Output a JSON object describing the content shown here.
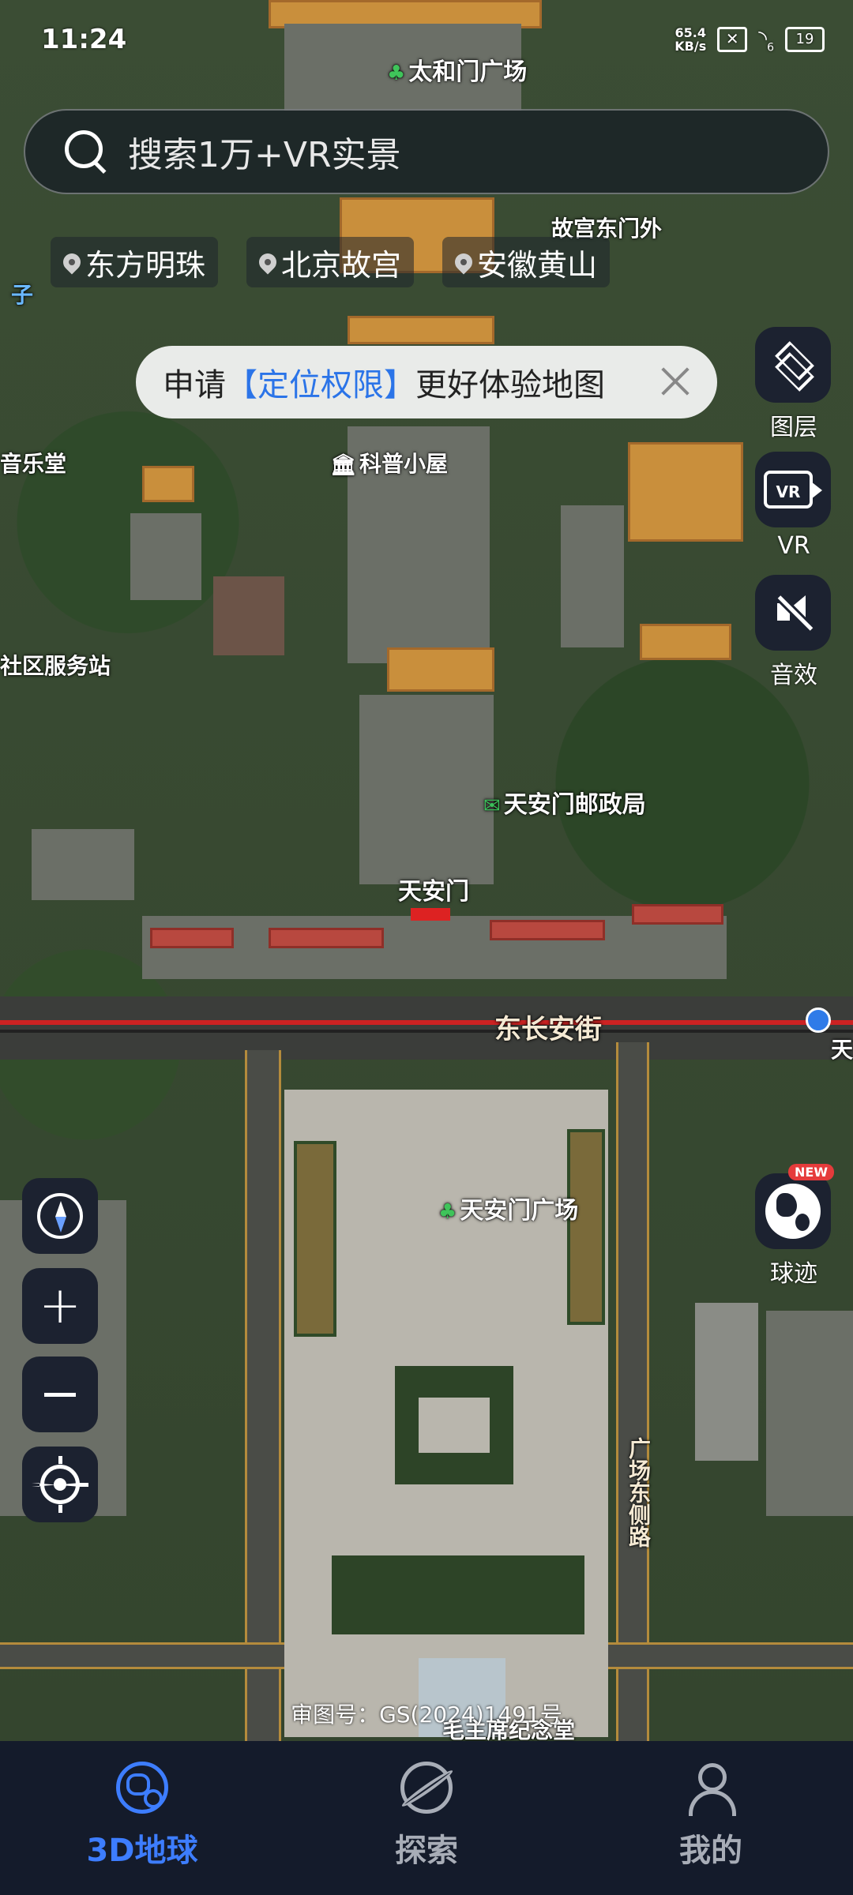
{
  "status_bar": {
    "time": "11:24",
    "net_speed_value": "65.4",
    "net_speed_unit": "KB/s",
    "wifi_level": "6",
    "battery": "19"
  },
  "search": {
    "placeholder": "搜索1万+VR实景"
  },
  "quick_places": [
    "东方明珠",
    "北京故宫",
    "安徽黄山"
  ],
  "permission_banner": {
    "prefix": "申请",
    "highlight": "【定位权限】",
    "suffix": "更好体验地图"
  },
  "right_tools": {
    "layers": "图层",
    "vr": "VR",
    "vr_icon_text": "VR",
    "sound": "音效",
    "trace": "球迹",
    "trace_badge": "NEW"
  },
  "map_labels": {
    "taihemen": "太和门广场",
    "east_gate": "故宫东门外",
    "kepu": "科普小屋",
    "music": "音乐堂",
    "community": "社区服务站",
    "post_office": "天安门邮政局",
    "tiananmen": "天安门",
    "changan": "东长安街",
    "square": "天安门广场",
    "square_east_road": "广场东侧路",
    "mausoleum": "毛主席纪念堂",
    "edge_left": "子",
    "edge_right": "天"
  },
  "approval_number": "审图号：GS(2024)1491号",
  "bottom_nav": [
    {
      "label": "3D地球",
      "active": true
    },
    {
      "label": "探索",
      "active": false
    },
    {
      "label": "我的",
      "active": false
    }
  ],
  "colors": {
    "accent": "#3d7dff",
    "nav_bg": "#141b2b",
    "tool_bg": "#1c2230",
    "banner_highlight": "#2b74e8"
  }
}
